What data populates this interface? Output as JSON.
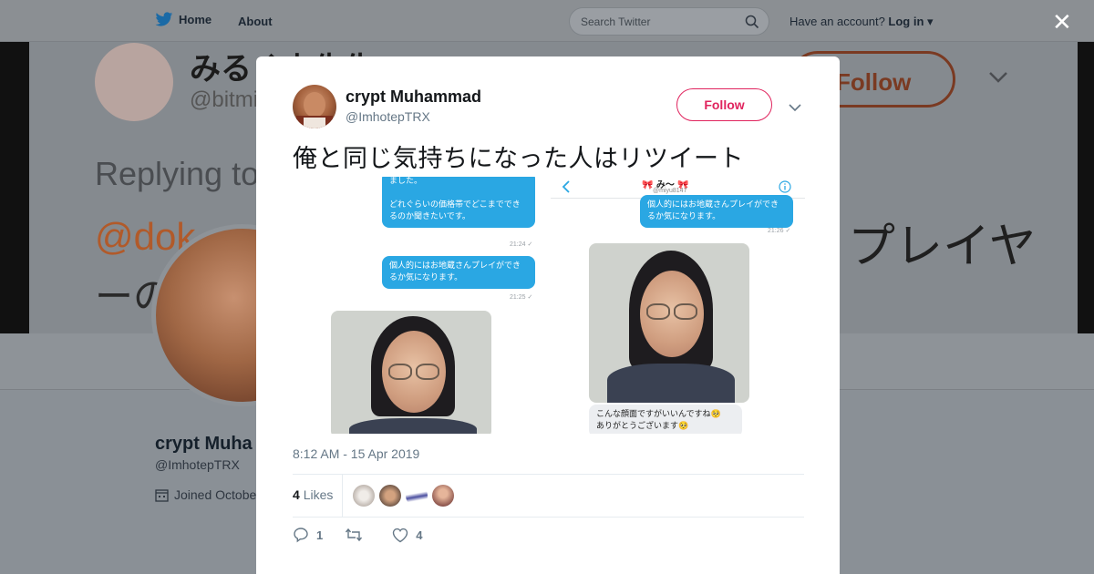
{
  "nav": {
    "home_label": "Home",
    "about_label": "About",
    "search_placeholder": "Search Twitter",
    "account_prompt": "Have an account?",
    "login_label": "Log in"
  },
  "background_profile": {
    "tweet_name": "みるく上先生",
    "tweet_handle": "@bitmi",
    "replying_to": "Replying to",
    "mention_fragment": "@dok",
    "line2_fragment": "ーの",
    "right_fragment": "プレイヤ",
    "follow_label": "Follow",
    "profile_name": "crypt Muha",
    "profile_handle": "@ImhotepTRX",
    "joined": "Joined Octobe"
  },
  "tweet": {
    "author_name": "crypt Muhammad",
    "author_handle": "@ImhotepTRX",
    "follow_label": "Follow",
    "text": "俺と同じ気持ちになった人はリツイート",
    "timestamp": "8:12 AM - 15 Apr 2019",
    "likes_count": "4",
    "likes_label": "Likes",
    "reply_count": "1",
    "retweet_count": "",
    "like_count": "4"
  },
  "media": {
    "left": {
      "bubble1": "ました。\n\nどれぐらいの価格帯でどこまでできるのか聞きたいです。",
      "ts1": "21:24 ✓",
      "bubble2": "個人的にはお地蔵さんプレイができるか気になります。",
      "ts2": "21:25 ✓"
    },
    "right": {
      "title": "🎀 み〜 🎀",
      "subtitle": "@miyu8147",
      "bubble1": "個人的にはお地蔵さんプレイができるか気になります。",
      "ts1": "21:26 ✓",
      "caption": "こんな顔面ですがいいんですね🥺\nありがとうございます🥺"
    }
  },
  "colors": {
    "brand": "#1da1f2",
    "follow_accent": "#e0245e",
    "overlay": "#8a9096"
  }
}
